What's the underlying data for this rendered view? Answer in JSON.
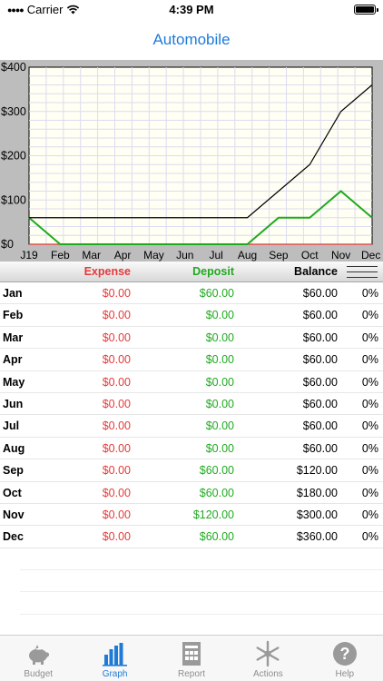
{
  "status": {
    "carrier": "Carrier",
    "time": "4:39 PM"
  },
  "nav": {
    "title": "Automobile"
  },
  "chart_data": {
    "type": "line",
    "title": "",
    "ylim": [
      0,
      400
    ],
    "y_ticks": [
      "$0",
      "$100",
      "$200",
      "$300",
      "$400"
    ],
    "x_ticks": [
      "J19",
      "Feb",
      "Mar",
      "Apr",
      "May",
      "Jun",
      "Jul",
      "Aug",
      "Sep",
      "Oct",
      "Nov",
      "Dec"
    ],
    "grid": true,
    "series": [
      {
        "values": [
          60,
          60,
          60,
          60,
          60,
          60,
          60,
          60,
          120,
          180,
          300,
          360
        ],
        "color": "#000000"
      },
      {
        "values": [
          60,
          0,
          0,
          0,
          0,
          0,
          0,
          0,
          60,
          60,
          120,
          60
        ],
        "color": "#1faa1f"
      },
      {
        "values": [
          0,
          0,
          0,
          0,
          0,
          0,
          0,
          0,
          0,
          0,
          0,
          0
        ],
        "color": "#e53a3a"
      }
    ]
  },
  "table": {
    "headers": {
      "expense": "Expense",
      "deposit": "Deposit",
      "balance": "Balance"
    },
    "rows": [
      {
        "month": "Jan",
        "expense": "$0.00",
        "deposit": "$60.00",
        "balance": "$60.00",
        "pct": "0%"
      },
      {
        "month": "Feb",
        "expense": "$0.00",
        "deposit": "$0.00",
        "balance": "$60.00",
        "pct": "0%"
      },
      {
        "month": "Mar",
        "expense": "$0.00",
        "deposit": "$0.00",
        "balance": "$60.00",
        "pct": "0%"
      },
      {
        "month": "Apr",
        "expense": "$0.00",
        "deposit": "$0.00",
        "balance": "$60.00",
        "pct": "0%"
      },
      {
        "month": "May",
        "expense": "$0.00",
        "deposit": "$0.00",
        "balance": "$60.00",
        "pct": "0%"
      },
      {
        "month": "Jun",
        "expense": "$0.00",
        "deposit": "$0.00",
        "balance": "$60.00",
        "pct": "0%"
      },
      {
        "month": "Jul",
        "expense": "$0.00",
        "deposit": "$0.00",
        "balance": "$60.00",
        "pct": "0%"
      },
      {
        "month": "Aug",
        "expense": "$0.00",
        "deposit": "$0.00",
        "balance": "$60.00",
        "pct": "0%"
      },
      {
        "month": "Sep",
        "expense": "$0.00",
        "deposit": "$60.00",
        "balance": "$120.00",
        "pct": "0%"
      },
      {
        "month": "Oct",
        "expense": "$0.00",
        "deposit": "$60.00",
        "balance": "$180.00",
        "pct": "0%"
      },
      {
        "month": "Nov",
        "expense": "$0.00",
        "deposit": "$120.00",
        "balance": "$300.00",
        "pct": "0%"
      },
      {
        "month": "Dec",
        "expense": "$0.00",
        "deposit": "$60.00",
        "balance": "$360.00",
        "pct": "0%"
      }
    ]
  },
  "tabs": [
    {
      "label": "Budget",
      "icon": "piggy-bank-icon"
    },
    {
      "label": "Graph",
      "icon": "bar-chart-icon",
      "active": true
    },
    {
      "label": "Report",
      "icon": "report-icon"
    },
    {
      "label": "Actions",
      "icon": "snowflake-icon"
    },
    {
      "label": "Help",
      "icon": "help-icon"
    }
  ]
}
